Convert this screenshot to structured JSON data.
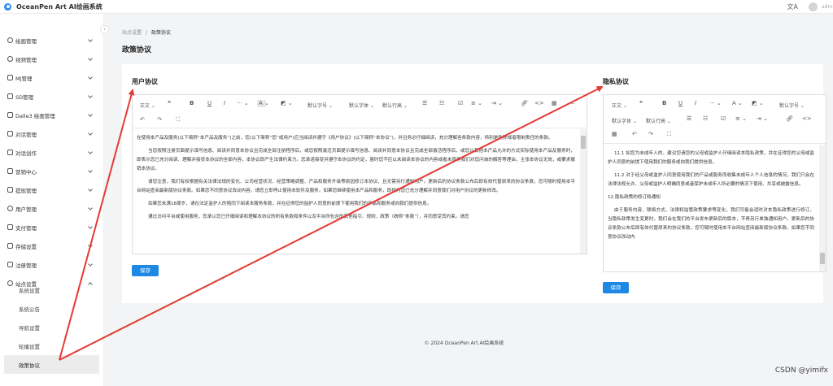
{
  "app": {
    "title": "OceanPen Art AI绘画系统",
    "translate_icon": "translate-icon",
    "admin": "admin"
  },
  "sidebar": {
    "items": [
      {
        "label": "绘画管理",
        "icon": "circle-icon"
      },
      {
        "label": "视频管理",
        "icon": "circle-icon"
      },
      {
        "label": "MJ管理",
        "icon": "image-icon"
      },
      {
        "label": "SD管理",
        "icon": "image-icon"
      },
      {
        "label": "Dalle3 绘画管理",
        "icon": "image-icon"
      },
      {
        "label": "对话管理",
        "icon": "chat-icon"
      },
      {
        "label": "对话创作",
        "icon": "chat-icon"
      },
      {
        "label": "营销中心",
        "icon": "cart-icon"
      },
      {
        "label": "提现管理",
        "icon": "wallet-icon"
      },
      {
        "label": "用户管理",
        "icon": "user-icon"
      },
      {
        "label": "支付管理",
        "icon": "folder-icon"
      },
      {
        "label": "存储设置",
        "icon": "storage-icon"
      },
      {
        "label": "注册管理",
        "icon": "register-icon"
      },
      {
        "label": "站点设置",
        "icon": "gear-icon"
      }
    ],
    "subitems": [
      "系统设置",
      "系统公告",
      "导航设置",
      "轮播设置",
      "政策协议"
    ]
  },
  "breadcrumb": {
    "parent": "站点设置",
    "sep": "/",
    "current": "政策协议"
  },
  "page_title": "政策协议",
  "user_agreement": {
    "title": "用户协议",
    "toolbar": {
      "paragraph": "正文",
      "font_size": "默认字号",
      "font": "默认字体",
      "line_height": "默认行高"
    },
    "paragraphs": [
      "在使用本产品及服务(以下简称“本产品及服务”)之前，您(以下简称“您”或用户)应当阅读并遵守《用户协议》(以下简称“本协议”)，并且务必仔细阅读，充分理解各条款内容，特别是免除或者限制责任的条款。",
      "当您按照注册页面提示填写信息、阅读并同意本协议且完成全部注册程序后，或您按照激活页面提示填写信息、阅读并同意本协议且完成全部激活程序后，或您以其他本产品允许的方式实际使用本产品及服务时，即表示您已充分阅读、理解并接受本协议的全部内容，本协议即产生法律约束力。您承诺接受并遵守本协议的约定，届时您不应以未阅读本协议的内容或者未获得我们对您问询的解答等理由，主张本协议无效，或要求撤销本协议。",
      "请您注意，我们有权根据有关法律法规的变化、公司经营状况、经营策略调整、产品和服务升级等原因修订本协议，且无需另行通知用户。更新后的协议条款公布后即有效代替原来的协议条款，您可随时使用本平台网站查阅最新版协议条款。如果您不同意协议改动内容，请您立即停止使用本软件及服务。如果您继续使用本产品和服务，即视为您已充分理解并同意我们对用户协议的更新修改。",
      "如果您未满18周岁，请在法定监护人的陪同下阅读本服务条款，并在征得您的监护人同意的前提下使用我们的产品和服务或向我们提供信息。",
      "通过访问平台或使用服务，您承认您已仔细阅读和理解本协议的所有条款和条件以及平台所包含的其他指引、规则、政策（统称“条款”），并同意受其约束。请您"
    ],
    "save_label": "保存"
  },
  "privacy_agreement": {
    "title": "隐私协议",
    "toolbar": {
      "paragraph": "正文",
      "font_size": "默认字号",
      "font": "默认字体",
      "line_height": "默认行高"
    },
    "paragraphs": [
      "11.1 如您为未成年人的，建议您请您的父母或监护人仔细阅读本隐私政策，并在征得您的父母或监护人同意的前提下使用我们的服务或向我们提供信息。",
      "11.2 对于经父母或监护人同意使用我们的产品或服务而收集未成年人个人信息的情况，我们只会在法律法规允许、父母或监护人明确同意或者保护未成年人所必要的情况下使用、共享或披露信息。",
      "12.隐私政策的修订和通知",
      "由于服务内容、联络方式、法律和监管政策要求等变化，我们可能会适时对本隐私政策进行修订。当隐私政策发生变更时，我们会在我们的平台发布更新后的版本，不再另行单独通知用户。更新后的协议条款公布后即有效代替原来的协议条款，您可随时使用本平台网站查阅最新版协议条款。如果您不同意协议改动内"
    ],
    "save_label": "保存"
  },
  "footer": "© 2024 OceanPen Art AI绘画系统",
  "watermark": "CSDN @yimifx",
  "colors": {
    "primary": "#1e88e5",
    "arrow": "#e53935"
  }
}
